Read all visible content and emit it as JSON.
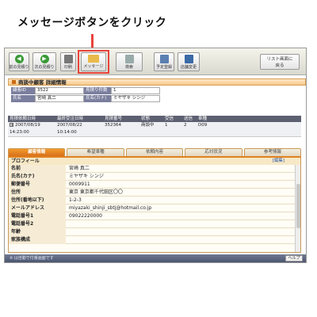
{
  "instruction": "メッセージボタンをクリック",
  "toolbar": {
    "buttons": [
      {
        "label": "前の見積り",
        "icon": "arrow-left-icon"
      },
      {
        "label": "次の見積り",
        "icon": "arrow-right-icon"
      },
      {
        "label": "印刷",
        "icon": "printer-icon"
      },
      {
        "label": "メッセージ",
        "icon": "folder-icon"
      },
      {
        "label": "検索",
        "icon": "search-icon"
      },
      {
        "label": "予定登録",
        "icon": "calendar-icon"
      },
      {
        "label": "店舗変更",
        "icon": "window-icon"
      }
    ],
    "list_button": [
      "リスト画面に",
      "戻る"
    ]
  },
  "detail": {
    "title": "商談中顧客 詳細情報",
    "fields": [
      {
        "key": "顧客ID",
        "value": "3522"
      },
      {
        "key": "見積り件数",
        "value": "1"
      },
      {
        "key": "氏名",
        "value": "宮崎 真二"
      },
      {
        "key": "氏名(カナ)",
        "value": "ミヤザキ シンジ"
      }
    ]
  },
  "history": {
    "headers": [
      "見積依頼日時",
      "最終受注日時",
      "見積番号",
      "状態",
      "受信",
      "送信",
      "車種",
      ""
    ],
    "row": [
      "2007/08/19 14:23:00",
      "2007/08/22 10:14:00",
      "352364",
      "商談中",
      "1",
      "2",
      "D09",
      ""
    ]
  },
  "tabs": [
    "顧客情報",
    "希望車種",
    "依頼内容",
    "応対状況",
    "参考情報"
  ],
  "profile": {
    "header": "プロフィール",
    "edit_link": "[編集]",
    "rows": [
      {
        "key": "名前",
        "value": "宮崎 真二"
      },
      {
        "key": "氏名(カナ)",
        "value": "ミヤザキ シンジ"
      },
      {
        "key": "郵便番号",
        "value": "0009911"
      },
      {
        "key": "住所",
        "value": "東京 東京都千代田区〇〇"
      },
      {
        "key": "住所(番地以下)",
        "value": "1-2-3"
      },
      {
        "key": "メールアドレス",
        "value": "miyazaki_shinji_sbtj@hotmail.co.jp"
      },
      {
        "key": "電話番号1",
        "value": "09022220000"
      },
      {
        "key": "電話番号2",
        "value": ""
      },
      {
        "key": "年齢",
        "value": ""
      },
      {
        "key": "家族構成",
        "value": ""
      }
    ]
  },
  "statusbar": {
    "text": "※ は自動で付番画面です",
    "help": "ヘルプ"
  }
}
